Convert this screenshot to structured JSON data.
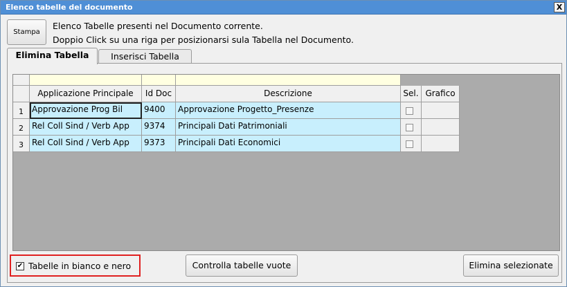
{
  "window": {
    "title": "Elenco tabelle del documento",
    "close_label": "X"
  },
  "toolbar": {
    "stampa_label": "Stampa"
  },
  "info": {
    "line1": "Elenco Tabelle presenti nel Documento corrente.",
    "line2": "Doppio Click su una riga per posizionarsi sula Tabella nel Documento."
  },
  "tabs": [
    {
      "label": "Elimina Tabella",
      "active": true
    },
    {
      "label": "Inserisci Tabella",
      "active": false
    }
  ],
  "table": {
    "headers": [
      "Applicazione Principale",
      "Id Doc",
      "Descrizione",
      "Sel.",
      "Grafico"
    ],
    "rows": [
      {
        "num": "1",
        "app": "Approvazione Prog Bil",
        "id": "9400",
        "desc": "Approvazione Progetto_Presenze",
        "sel": false
      },
      {
        "num": "2",
        "app": "Rel Coll Sind / Verb App",
        "id": "9374",
        "desc": "Principali Dati Patrimoniali",
        "sel": false
      },
      {
        "num": "3",
        "app": "Rel Coll Sind / Verb App",
        "id": "9373",
        "desc": "Principali Dati Economici",
        "sel": false
      }
    ]
  },
  "footer": {
    "bw_checkbox_label": "Tabelle in bianco e nero",
    "bw_checked": true,
    "bw_check_glyph": "✔",
    "controlla_label": "Controlla tabelle vuote",
    "elimina_label": "Elimina selezionate"
  }
}
